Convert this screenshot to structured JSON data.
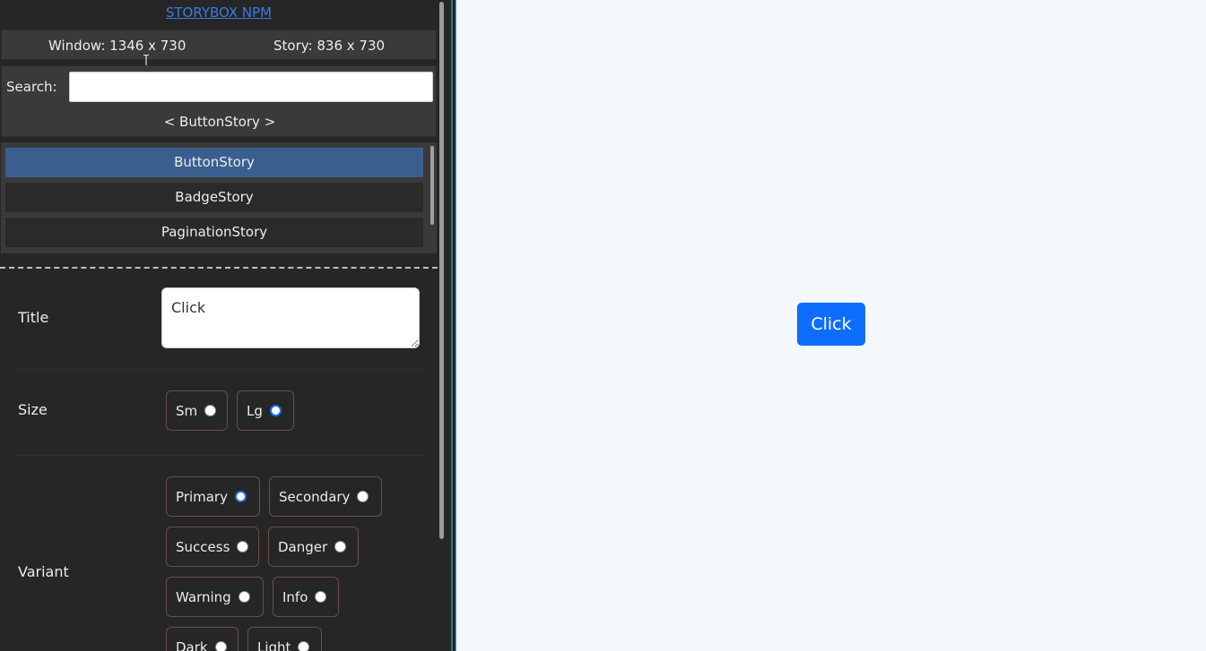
{
  "header": {
    "npm_link": "STORYBOX NPM",
    "window_size": "Window: 1346 x 730",
    "story_size": "Story: 836 x 730"
  },
  "search": {
    "label": "Search:",
    "value": "",
    "placeholder": ""
  },
  "current_story": "< ButtonStory >",
  "stories": [
    {
      "label": "ButtonStory",
      "active": true
    },
    {
      "label": "BadgeStory",
      "active": false
    },
    {
      "label": "PaginationStory",
      "active": false
    }
  ],
  "props": {
    "title": {
      "label": "Title",
      "value": "Click"
    },
    "size": {
      "label": "Size",
      "options": [
        {
          "label": "Sm",
          "checked": false
        },
        {
          "label": "Lg",
          "checked": true
        }
      ]
    },
    "variant": {
      "label": "Variant",
      "options": [
        {
          "label": "Primary",
          "checked": true
        },
        {
          "label": "Secondary",
          "checked": false
        },
        {
          "label": "Success",
          "checked": false
        },
        {
          "label": "Danger",
          "checked": false
        },
        {
          "label": "Warning",
          "checked": false
        },
        {
          "label": "Info",
          "checked": false
        },
        {
          "label": "Dark",
          "checked": false
        },
        {
          "label": "Light",
          "checked": false
        }
      ]
    }
  },
  "preview": {
    "button_label": "Click",
    "button_color": "#0d6efd"
  },
  "colors": {
    "sidebar_bg": "#262626",
    "active_story": "#3a5f8f",
    "preview_bg": "#f4f7fb",
    "link": "#3b7be0"
  }
}
